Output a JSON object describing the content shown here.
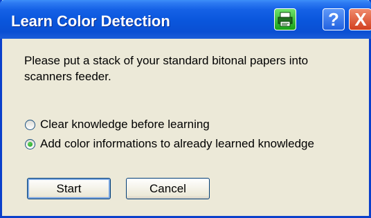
{
  "window": {
    "title": "Learn Color Detection",
    "titlebar_buttons": {
      "print": "printer-icon",
      "help": "?",
      "close": "X"
    }
  },
  "message": "Please put a stack of your standard bitonal papers into scanners feeder.",
  "options": [
    {
      "label": "Clear knowledge before learning",
      "selected": false
    },
    {
      "label": "Add color informations to already learned knowledge",
      "selected": true
    }
  ],
  "buttons": {
    "start": "Start",
    "cancel": "Cancel"
  },
  "colors": {
    "titlebar": "#0A56DC",
    "dialog_background": "#ECE9D8",
    "radio_dot": "#21A121"
  }
}
